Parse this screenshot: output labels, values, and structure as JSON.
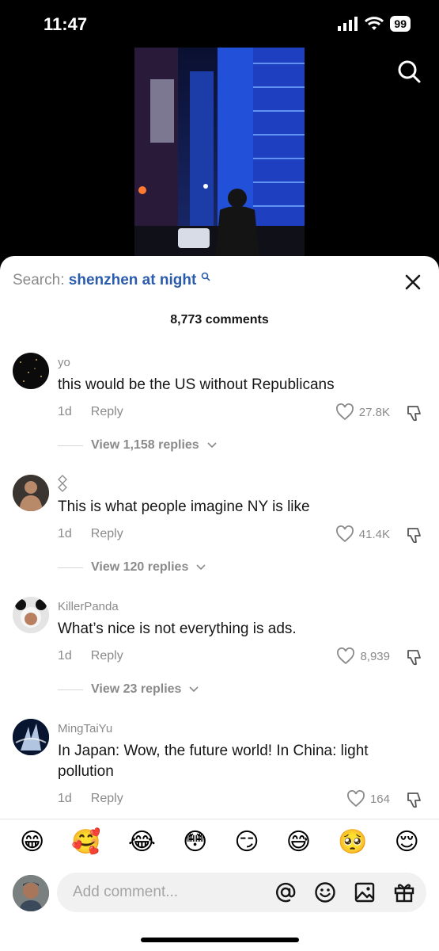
{
  "status": {
    "time": "11:47",
    "battery": "99"
  },
  "search": {
    "label": "Search:",
    "query": "shenzhen at night"
  },
  "comment_count": "8,773 comments",
  "comments": [
    {
      "user": "yo",
      "text": "this would be the US without Republicans",
      "age": "1d",
      "reply": "Reply",
      "likes": "27.8K",
      "replies": "View 1,158 replies"
    },
    {
      "user": "",
      "text": "This is what people imagine NY is like",
      "age": "1d",
      "reply": "Reply",
      "likes": "41.4K",
      "replies": "View 120 replies"
    },
    {
      "user": "KillerPanda",
      "text": "What’s nice is not everything is ads.",
      "age": "1d",
      "reply": "Reply",
      "likes": "8,939",
      "replies": "View 23 replies"
    },
    {
      "user": "MingTaiYu",
      "text": "In Japan: Wow, the future world! In China: light pollution",
      "age": "1d",
      "reply": "Reply",
      "likes": "164"
    }
  ],
  "emojis": [
    "😁",
    "🥰",
    "😂",
    "😳",
    "😏",
    "😅",
    "🥺",
    "😌"
  ],
  "input": {
    "placeholder": "Add comment..."
  },
  "colors": {
    "accent_link": "#2b5cab",
    "muted": "#8a8a8a",
    "text": "#161616"
  }
}
